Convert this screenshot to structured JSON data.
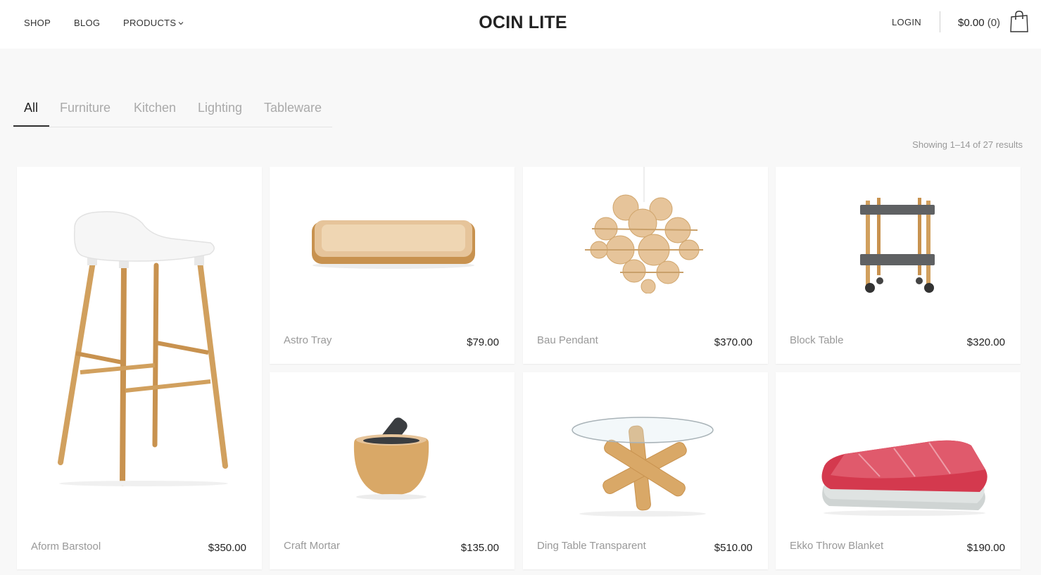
{
  "header": {
    "nav": [
      {
        "label": "SHOP"
      },
      {
        "label": "BLOG"
      },
      {
        "label": "PRODUCTS"
      }
    ],
    "logo": "OCIN LITE",
    "login": "LOGIN",
    "cart_total": "$0.00",
    "cart_count": "(0)"
  },
  "filters": {
    "tabs": [
      {
        "label": "All",
        "active": true
      },
      {
        "label": "Furniture",
        "active": false
      },
      {
        "label": "Kitchen",
        "active": false
      },
      {
        "label": "Lighting",
        "active": false
      },
      {
        "label": "Tableware",
        "active": false
      }
    ],
    "result_count": "Showing 1–14 of 27 results"
  },
  "products": [
    {
      "title": "Aform Barstool",
      "price": "$350.00",
      "icon": "barstool-image"
    },
    {
      "title": "Astro Tray",
      "price": "$79.00",
      "icon": "tray-image"
    },
    {
      "title": "Bau Pendant",
      "price": "$370.00",
      "icon": "pendant-lamp-image"
    },
    {
      "title": "Block Table",
      "price": "$320.00",
      "icon": "trolley-table-image"
    },
    {
      "title": "Craft Mortar",
      "price": "$135.00",
      "icon": "mortar-image"
    },
    {
      "title": "Ding Table Transparent",
      "price": "$510.00",
      "icon": "glass-table-image"
    },
    {
      "title": "Ekko Throw Blanket",
      "price": "$190.00",
      "icon": "folded-blanket-image"
    }
  ],
  "colors": {
    "background": "#f8f8f8",
    "text_dark": "#222222",
    "text_muted": "#999999",
    "wood": "#d9a867"
  }
}
